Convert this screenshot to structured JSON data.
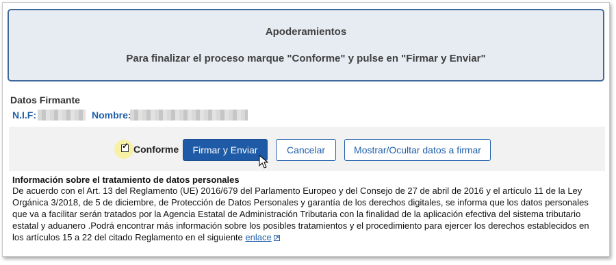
{
  "header": {
    "title": "Apoderamientos",
    "instruction": "Para finalizar el proceso marque \"Conforme\" y pulse en \"Firmar y Enviar\""
  },
  "signer": {
    "section_title": "Datos Firmante",
    "nif_label": "N.I.F:",
    "name_label": "Nombre:"
  },
  "actions": {
    "conforme_label": "Conforme",
    "conforme_checked": true,
    "sign_button": "Firmar y Enviar",
    "cancel_button": "Cancelar",
    "toggle_button": "Mostrar/Ocultar datos a firmar"
  },
  "info": {
    "title": "Información sobre el tratamiento de datos personales",
    "body": "De acuerdo con el Art. 13 del Reglamento (UE) 2016/679 del Parlamento Europeo y del Consejo de 27 de abril de 2016 y el artículo 11 de la Ley Orgánica 3/2018, de 5 de diciembre, de Protección de Datos Personales y garantía de los derechos digitales, se informa que los datos personales que va a facilitar serán tratados por la Agencia Estatal de Administración Tributaria con la finalidad de la aplicación efectiva del sistema tributario estatal y aduanero .Podrá encontrar más información sobre los posibles tratamientos y el procedimiento para ejercer los derechos establecidos en los artículos 15 a 22 del citado Reglamento en el siguiente ",
    "link_text": "enlace",
    "link_icon": "external-link-icon"
  },
  "colors": {
    "header_background": "#e7ecf3",
    "header_border": "#41689a",
    "primary_blue": "#1e5aa6",
    "link_blue": "#1f5faa",
    "highlight_yellow": "#f6f1a5"
  }
}
